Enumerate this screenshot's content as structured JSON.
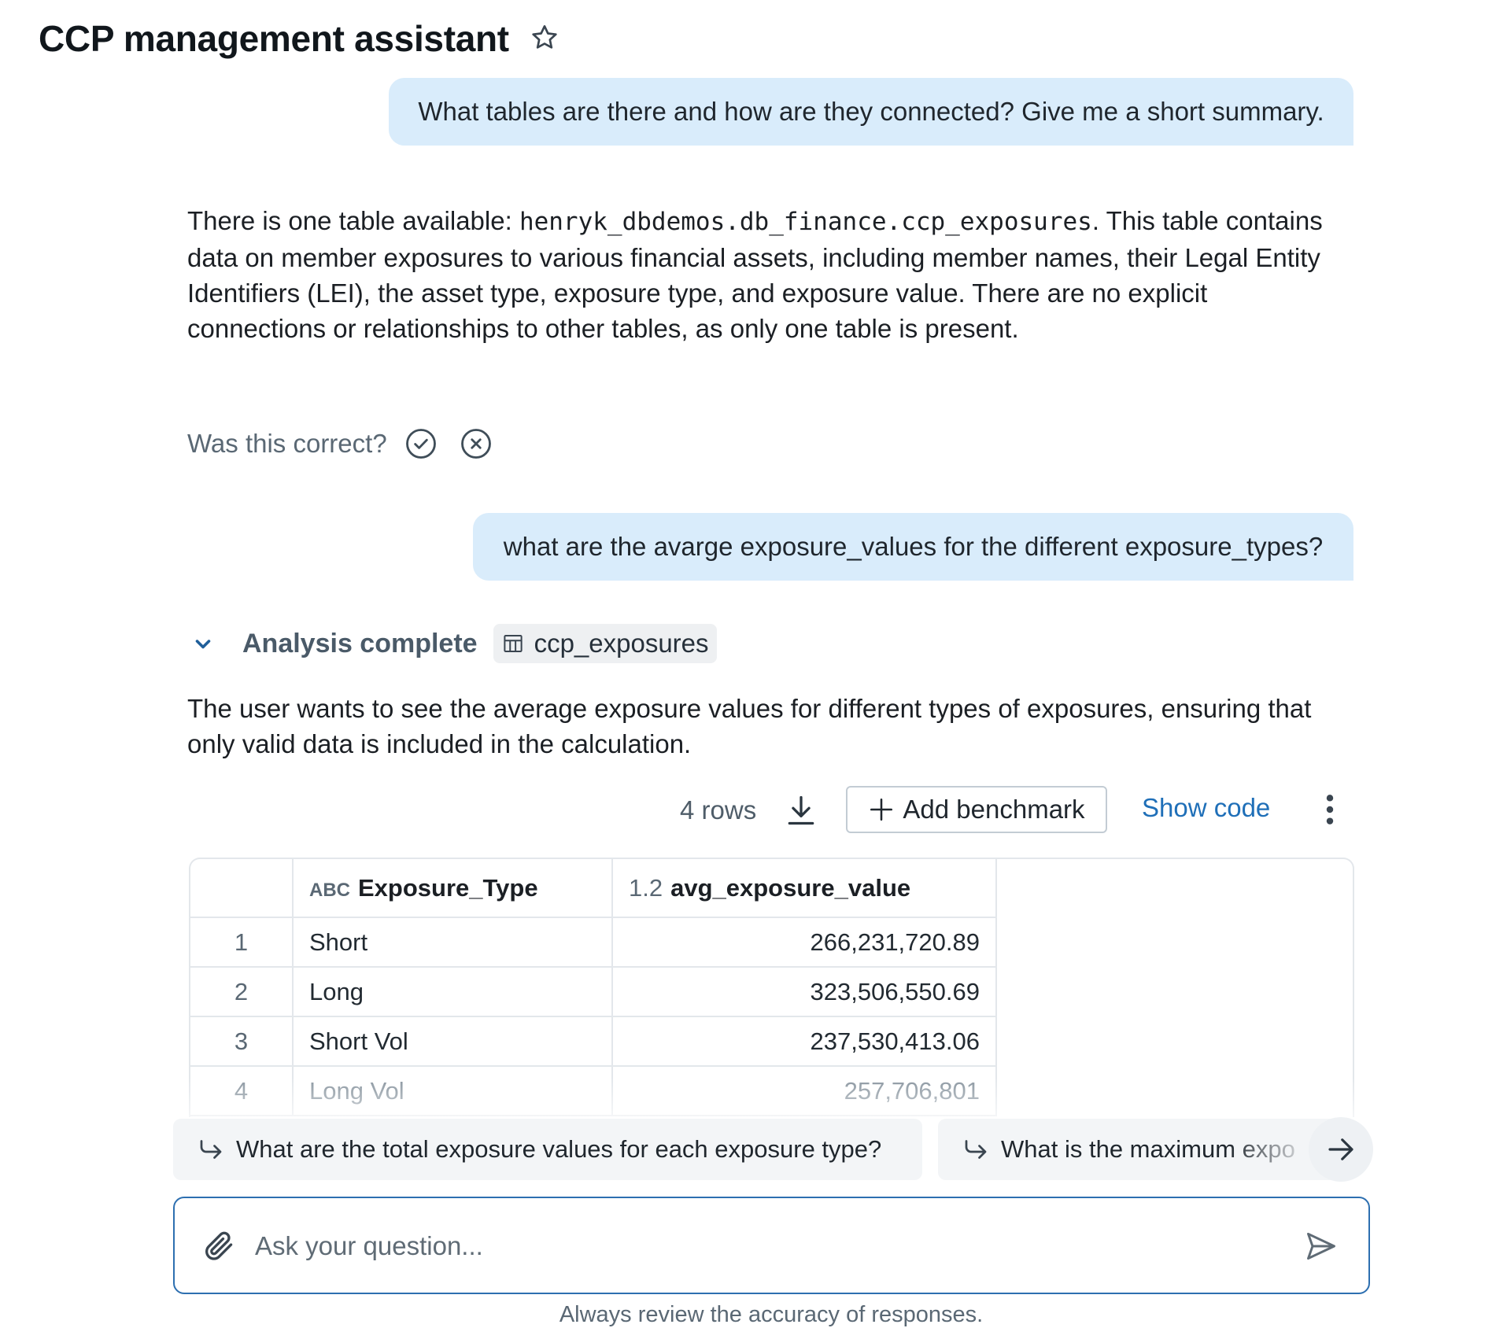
{
  "header": {
    "title": "CCP management assistant",
    "favorite_icon": "star-icon"
  },
  "conversation": {
    "q1": "What tables are there and how are they connected? Give me a short summary.",
    "a1": {
      "before_code": "There is one table available: ",
      "code": "henryk_dbdemos.db_finance.ccp_exposures",
      "after_code": ". This table contains data on member exposures to various financial assets, including member names, their Legal Entity Identifiers (LEI), the asset type, exposure type, and exposure value. There are no explicit connections or relationships to other tables, as only one table is present."
    },
    "feedback": {
      "label": "Was this correct?",
      "yes_icon": "check-circle-icon",
      "no_icon": "x-circle-icon"
    },
    "q2": "what are the avarge exposure_values for the different exposure_types?",
    "analysis": {
      "status": "Analysis complete",
      "table_chip": "ccp_exposures"
    },
    "a2": "The user wants to see the average exposure values for different types of exposures, ensuring that only valid data is included in the calculation."
  },
  "result": {
    "rows_label": "4 rows",
    "add_benchmark": "Add benchmark",
    "show_code": "Show code",
    "columns": [
      {
        "type_icon": "ABC",
        "name": "Exposure_Type"
      },
      {
        "type_icon": "1.2",
        "name": "avg_exposure_value"
      }
    ],
    "rows": [
      {
        "idx": "1",
        "type": "Short",
        "value": "266,231,720.89"
      },
      {
        "idx": "2",
        "type": "Long",
        "value": "323,506,550.69"
      },
      {
        "idx": "3",
        "type": "Short Vol",
        "value": "237,530,413.06"
      },
      {
        "idx": "4",
        "type": "Long Vol",
        "value": "257,706,801"
      }
    ]
  },
  "suggestions": [
    "What are the total exposure values for each exposure type?",
    "What is the maximum expo"
  ],
  "composer": {
    "placeholder": "Ask your question...",
    "value": ""
  },
  "footer": {
    "disclaimer": "Always review the accuracy of responses."
  },
  "colors": {
    "user_bubble": "#d9ecfb",
    "accent": "#1f6fb8",
    "input_border": "#2d6fb0"
  }
}
